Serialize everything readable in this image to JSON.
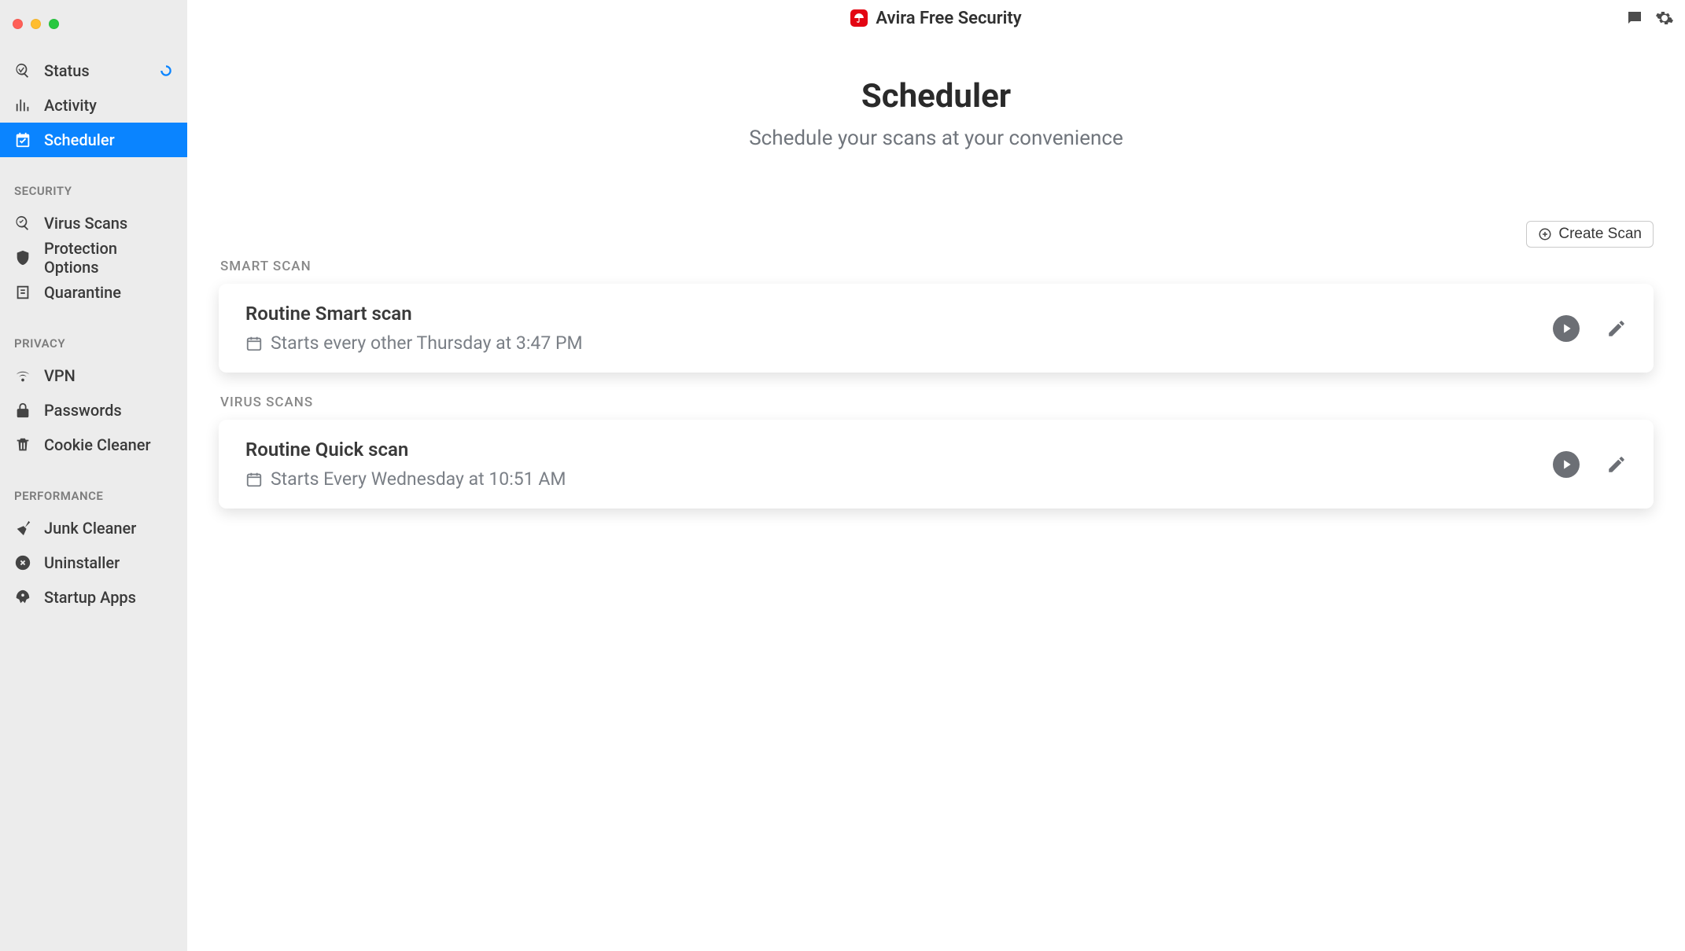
{
  "app": {
    "title": "Avira Free Security"
  },
  "sidebar": {
    "top": [
      {
        "label": "Status",
        "icon": "status"
      },
      {
        "label": "Activity",
        "icon": "activity"
      },
      {
        "label": "Scheduler",
        "icon": "scheduler",
        "selected": true
      }
    ],
    "sections": [
      {
        "title": "SECURITY",
        "items": [
          {
            "label": "Virus Scans",
            "icon": "magnify-check"
          },
          {
            "label": "Protection Options",
            "icon": "shield-check"
          },
          {
            "label": "Quarantine",
            "icon": "quarantine"
          }
        ]
      },
      {
        "title": "PRIVACY",
        "items": [
          {
            "label": "VPN",
            "icon": "wifi"
          },
          {
            "label": "Passwords",
            "icon": "lock"
          },
          {
            "label": "Cookie Cleaner",
            "icon": "trash"
          }
        ]
      },
      {
        "title": "PERFORMANCE",
        "items": [
          {
            "label": "Junk Cleaner",
            "icon": "broom"
          },
          {
            "label": "Uninstaller",
            "icon": "x-circle"
          },
          {
            "label": "Startup Apps",
            "icon": "rocket"
          }
        ]
      }
    ]
  },
  "page": {
    "title": "Scheduler",
    "subtitle": "Schedule your scans at your convenience",
    "create_label": "Create Scan",
    "groups": [
      {
        "header": "SMART SCAN",
        "items": [
          {
            "title": "Routine Smart scan",
            "schedule": "Starts every other Thursday at 3:47 PM"
          }
        ]
      },
      {
        "header": "VIRUS SCANS",
        "items": [
          {
            "title": "Routine Quick scan",
            "schedule": "Starts Every Wednesday at 10:51 AM"
          }
        ]
      }
    ]
  }
}
